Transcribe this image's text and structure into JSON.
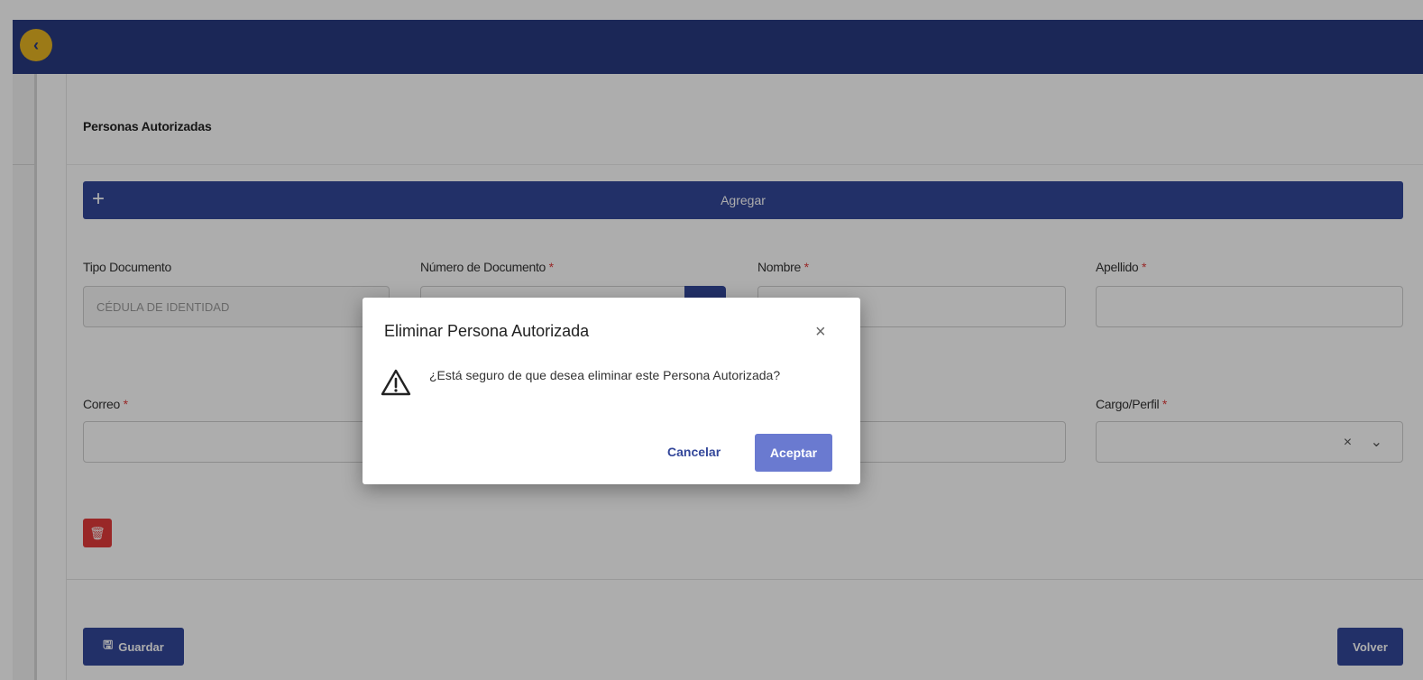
{
  "header": {
    "collapse_glyph": "‹"
  },
  "section": {
    "title": "Personas Autorizadas",
    "add_label": "Agregar",
    "add_glyph": "+"
  },
  "form": {
    "tipo_documento": {
      "label": "Tipo Documento",
      "value": "CÉDULA DE IDENTIDAD"
    },
    "numero_documento": {
      "label": "Número de Documento",
      "required": "*"
    },
    "nombre": {
      "label": "Nombre",
      "required": "*"
    },
    "apellido": {
      "label": "Apellido",
      "required": "*"
    },
    "correo": {
      "label": "Correo",
      "required": "*"
    },
    "cargo": {
      "label": "Cargo/Perfil",
      "required": "*",
      "icons": "× ⌄"
    }
  },
  "actions": {
    "delete_glyph": "🗑",
    "save_label": "Guardar",
    "save_glyph": "🖫",
    "back_label": "Volver"
  },
  "modal": {
    "title": "Eliminar Persona Autorizada",
    "close_glyph": "×",
    "message": "¿Está seguro de que desea eliminar este Persona Autorizada?",
    "cancel_label": "Cancelar",
    "accept_label": "Aceptar"
  },
  "colors": {
    "primary": "#33479a",
    "header": "#283a80",
    "danger": "#e23a3a",
    "accent": "#e6b422"
  }
}
